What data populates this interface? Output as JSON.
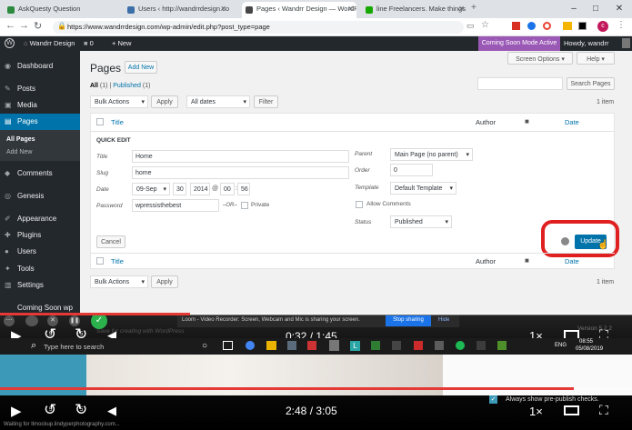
{
  "browser": {
    "tabs": [
      {
        "label": "AskQuesty Questions Need Answ",
        "fav_color": "#2b8a3e",
        "active": false
      },
      {
        "label": "Users ‹ http://wandrrdesign.com",
        "fav_color": "#3c6fa8",
        "active": false
      },
      {
        "label": "Pages ‹ Wandrr Design — WordP",
        "fav_color": "#464646",
        "active": true
      },
      {
        "label": "line Freelancers. Make things ha",
        "fav_color": "#14a800",
        "active": false
      }
    ],
    "url": "https://www.wandrrdesign.com/wp-admin/edit.php?post_type=page",
    "profile_initial": "c"
  },
  "adminbar": {
    "site_name": "Wandrr Design",
    "comments_count": "0",
    "new_label": "+ New",
    "coming_soon": "Coming Soon Mode Active",
    "howdy": "Howdy, wandrr"
  },
  "sidebar": {
    "items": [
      {
        "label": "Dashboard",
        "icon": "dashboard-icon",
        "glyph": "◉"
      },
      {
        "label": "Posts",
        "icon": "pin-icon",
        "glyph": "✎"
      },
      {
        "label": "Media",
        "icon": "media-icon",
        "glyph": "▣"
      },
      {
        "label": "Pages",
        "icon": "page-icon",
        "glyph": "▤"
      },
      {
        "label": "All Pages"
      },
      {
        "label": "Add New"
      },
      {
        "label": "Comments",
        "icon": "comment-icon",
        "glyph": "◆"
      },
      {
        "label": "Genesis",
        "icon": "genesis-icon",
        "glyph": "◎"
      },
      {
        "label": "Appearance",
        "icon": "brush-icon",
        "glyph": "✐"
      },
      {
        "label": "Plugins",
        "icon": "plugin-icon",
        "glyph": "✚"
      },
      {
        "label": "Users",
        "icon": "user-icon",
        "glyph": "●"
      },
      {
        "label": "Tools",
        "icon": "wrench-icon",
        "glyph": "✦"
      },
      {
        "label": "Settings",
        "icon": "settings-icon",
        "glyph": "▥"
      },
      {
        "label": "Coming Soon wp"
      }
    ]
  },
  "page": {
    "title": "Pages",
    "add_new": "Add New",
    "screen_options": "Screen Options ▾",
    "help": "Help ▾",
    "filter_all": "All",
    "filter_all_count": "(1)",
    "filter_sep": " | ",
    "filter_published": "Published",
    "filter_published_count": "(1)",
    "search_button": "Search Pages",
    "bulk_actions": "Bulk Actions",
    "apply": "Apply",
    "all_dates": "All dates",
    "filter": "Filter",
    "items_count": "1 item",
    "col_title": "Title",
    "col_author": "Author",
    "col_date": "Date"
  },
  "quick_edit": {
    "heading": "QUICK EDIT",
    "title_label": "Title",
    "title_value": "Home",
    "slug_label": "Slug",
    "slug_value": "home",
    "date_label": "Date",
    "month": "09-Sep",
    "day": "30",
    "year": "2014",
    "at": "@",
    "hour": "00",
    "colon": ":",
    "minute": "56",
    "password_label": "Password",
    "password_value": "wpressisthebest",
    "or": "–OR–",
    "private": "Private",
    "parent_label": "Parent",
    "parent_value": "Main Page (no parent)",
    "order_label": "Order",
    "order_value": "0",
    "template_label": "Template",
    "template_value": "Default Template",
    "allow_comments": "Allow Comments",
    "status_label": "Status",
    "status_value": "Published",
    "cancel": "Cancel",
    "update": "Update"
  },
  "loom": {
    "notice": "Loom - Video Recorder: Screen, Webcam and Mic is sharing your screen.",
    "stop": "Stop sharing",
    "hide": "Hide",
    "promo": "Save for creating with WordPress",
    "version": "Version 5.2.2"
  },
  "player1": {
    "time": "0:32 / 1:45",
    "speed": "1×",
    "progress": 0.3,
    "skip": "5"
  },
  "taskbar": {
    "search_placeholder": "Type here to search",
    "lang": "ENG",
    "time": "08:55",
    "date": "05/08/2019"
  },
  "player2": {
    "time": "2:48 / 3:05",
    "speed": "1×",
    "progress": 0.908,
    "skip": "5",
    "status": "Waiting for Ilmockup.lindyperphotography.com...",
    "checkbox_label": "Always show pre-publish checks."
  },
  "colors": {
    "wp_blue": "#0073aa",
    "admin_dark": "#23282d",
    "coming_soon": "#9b59b6",
    "highlight_red": "#e02020",
    "progress_red": "#e53935"
  }
}
